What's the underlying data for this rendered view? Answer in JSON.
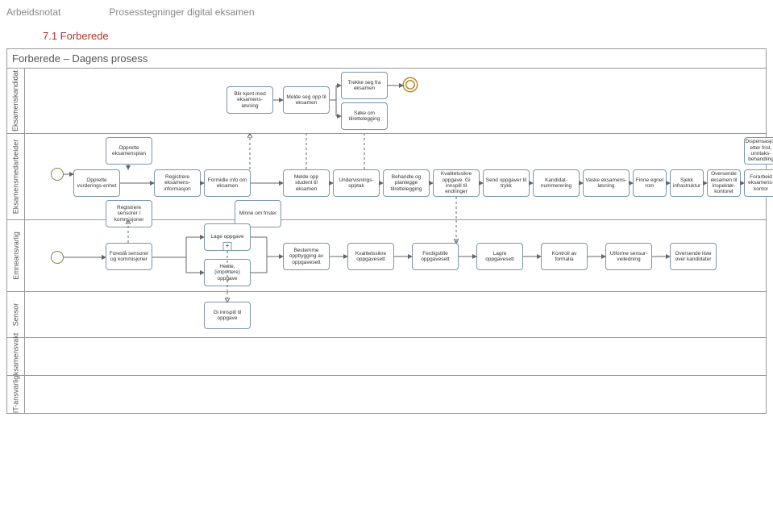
{
  "doc": {
    "type": "Arbeidsnotat",
    "title": "Prosesstegninger digital eksamen",
    "section": "7.1   Forberede",
    "pool_title": "Forberede – Dagens prosess"
  },
  "lanes": {
    "l1": "Eksamenskandidat",
    "l2": "Eksamensmedarbeider",
    "l3": "Emneansvarlig",
    "l4": "Sensor",
    "l5": "Eksamensvakt",
    "l6": "IT-ansvarlig"
  },
  "tasks": {
    "t_kjent": "Blir kjent med eksamens-løsning",
    "t_meldeopp": "Melde seg opp til eksamen",
    "t_trekke": "Trekke seg fra eksamen",
    "t_soke": "Søke om tilrettelegging",
    "t_oppretteplan": "Opprette eksamensplan",
    "t_vurdenhet": "Opprette vurderings-enhet",
    "t_reginfo": "Registrere eksamens-informasjon",
    "t_formidle": "Formidle info om eksamen",
    "t_meldestud": "Melde opp student til eksamen",
    "t_undopp": "Undervisnings-opptak",
    "t_behandle": "Behandle og planlegge tilrettelegging",
    "t_kvalinn": "Kvalitetssikre oppgave. Gi innspill til endringer",
    "t_sendtrykk": "Send oppgaver til trykk",
    "t_kandnum": "Kandidat-nummerering",
    "t_vaske": "Vaske eksamens-løsning",
    "t_finnerom": "Finne egnet rom",
    "t_sjekkinfra": "Sjekk infrastruktur",
    "t_oversende_insp": "Oversende eksamen til inspektør-kontoret",
    "t_forarbeid": "Forarbeid eksamens-kontor",
    "t_dispensasjon": "Dispensasjon etter frist, unntaks-behandling",
    "t_regsensor": "Registrere sensorer / kommisjoner",
    "t_minne": "Minne om frister",
    "t_foresla": "Foreslå sensorer og kommisjoner",
    "t_lageopp": "Lage oppgave",
    "t_hente": "Hente, (importere) oppgave",
    "t_bestemme": "Bestemme oppbygging av oppgavesett",
    "t_kvalsett": "Kvalitetssikre oppgavesett",
    "t_ferdig": "Ferdigstille oppgavesett",
    "t_lagre": "Lagre oppgavesett",
    "t_kontroll": "Kontroll av formalia",
    "t_utforme": "Utforme sensur-veiledning",
    "t_oversende_kand": "Oversende liste over kandidater",
    "t_giinnspill": "Gi innspill til oppgave"
  }
}
